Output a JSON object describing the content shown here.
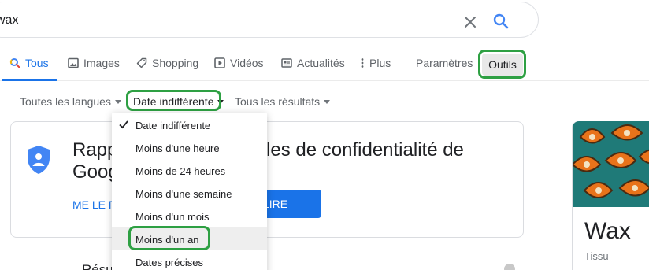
{
  "search": {
    "query": "wax"
  },
  "tabs": [
    {
      "label": "Tous",
      "icon": "google-g-icon"
    },
    {
      "label": "Images",
      "icon": "image-icon"
    },
    {
      "label": "Shopping",
      "icon": "tag-icon"
    },
    {
      "label": "Vidéos",
      "icon": "video-icon"
    },
    {
      "label": "Actualités",
      "icon": "news-icon"
    },
    {
      "label": "Plus",
      "icon": "more-vert-icon"
    }
  ],
  "settings_label": "Paramètres",
  "tools_label": "Outils",
  "filters": {
    "language": "Toutes les langues",
    "date": "Date indifférente",
    "results": "Tous les résultats"
  },
  "date_menu": {
    "items": [
      "Date indifférente",
      "Moins d'une heure",
      "Moins de 24 heures",
      "Moins d'une semaine",
      "Moins d'un mois",
      "Moins d'un an",
      "Dates précises"
    ],
    "selected": "Date indifférente",
    "hovered": "Moins d'un an"
  },
  "privacy_card": {
    "title_visible_left": "Rapp",
    "title_visible_right": "règles de confidentialité de",
    "title_line2": "Goog",
    "link_text": "ME LE R",
    "button_text": "LIRE"
  },
  "knowledge_panel": {
    "title": "Wax",
    "subtitle": "Tissu"
  },
  "results_partial": "Résu",
  "colors": {
    "accent": "#1a73e8",
    "highlight": "#2ea043"
  }
}
